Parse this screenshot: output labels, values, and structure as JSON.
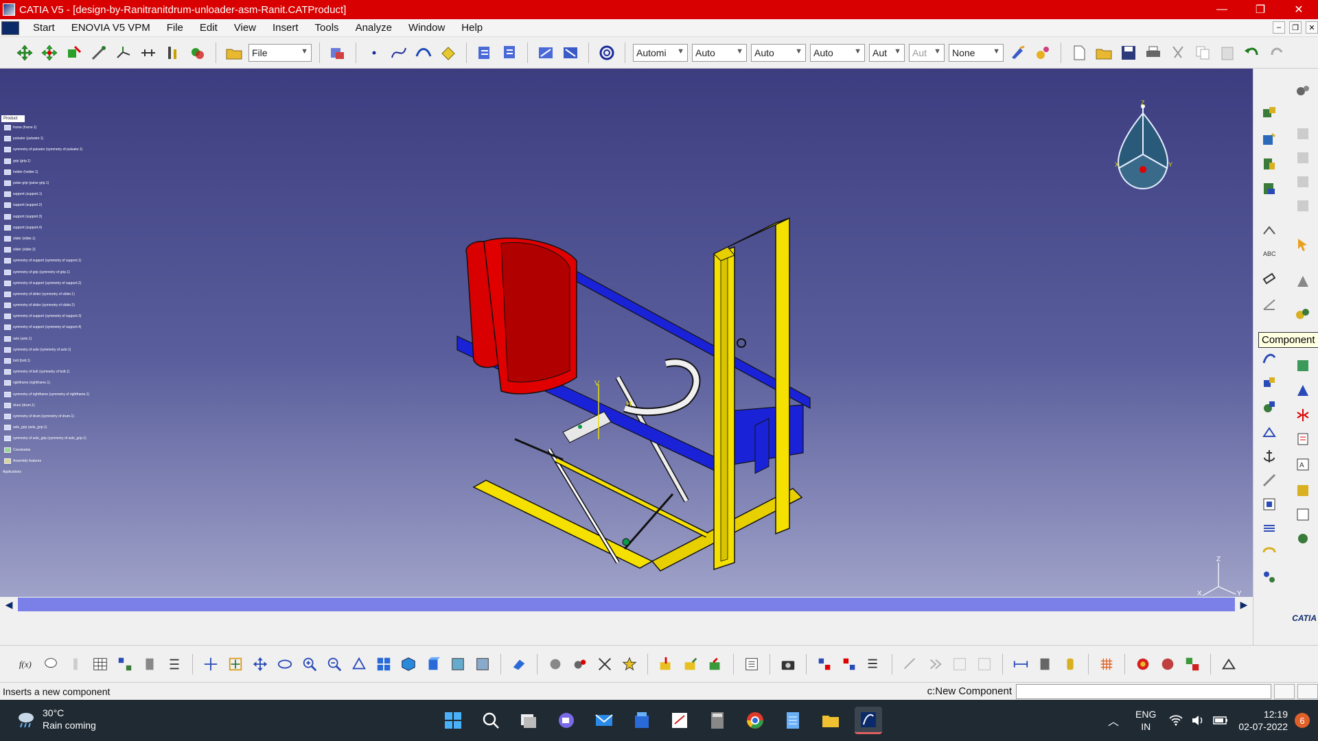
{
  "window": {
    "title": "CATIA V5 - [design-by-Ranitranitdrum-unloader-asm-Ranit.CATProduct]",
    "controls": [
      "—",
      "❐",
      "✕"
    ]
  },
  "menu": {
    "items": [
      {
        "label": "Start"
      },
      {
        "label": "ENOVIA V5 VPM"
      },
      {
        "label": "File"
      },
      {
        "label": "Edit"
      },
      {
        "label": "View"
      },
      {
        "label": "Insert"
      },
      {
        "label": "Tools"
      },
      {
        "label": "Analyze"
      },
      {
        "label": "Window"
      },
      {
        "label": "Help"
      }
    ]
  },
  "toolbar": {
    "file_combo": "File",
    "combos": [
      "Automi",
      "Auto",
      "Auto",
      "Auto",
      "Aut",
      "Aut",
      "None"
    ]
  },
  "tree": {
    "root": "Product",
    "nodes": [
      "frame (frame.1)",
      "pulsator (pulsator.1)",
      "symmetry of pulsator (symmetry of pulsator.1)",
      "grip (grip.1)",
      "holder (holder.1)",
      "pulse grip (pulse grip.1)",
      "support (support.1)",
      "support (support.2)",
      "support (support.3)",
      "support (support.4)",
      "slider (slider.1)",
      "slider (slider.2)",
      "symmetry of support (symmetry of support.1)",
      "symmetry of grip (symmetry of grip.1)",
      "symmetry of support (symmetry of support.2)",
      "symmetry of slider (symmetry of slider.1)",
      "symmetry of slider (symmetry of slider.2)",
      "symmetry of support (symmetry of support.3)",
      "symmetry of support (symmetry of support.4)",
      "axle (axle.1)",
      "symmetry of axle (symmetry of axle.1)",
      "bolt (bolt.1)",
      "symmetry of bolt (symmetry of bolt.1)",
      "rightframe (rightframe.1)",
      "symmetry of rightframe (symmetry of rightframe.1)",
      "drum (drum.1)",
      "symmetry of drum (symmetry of drum.1)",
      "axle_grip (axle_grip.1)",
      "symmetry of axle_grip (symmetry of axle_grip.1)",
      "Constraints",
      "Assembly features",
      "Applications"
    ]
  },
  "compass": {
    "axis_z": "Z",
    "axis_x": "X",
    "axis_y": "Y"
  },
  "axes": {
    "z": "Z",
    "x": "X",
    "y": "Y"
  },
  "tooltip": "Component",
  "logo": "CATIA",
  "status": {
    "message": "Inserts a new component",
    "command_label": "c:New Component"
  },
  "taskbar": {
    "weather_temp": "30°C",
    "weather_text": "Rain coming",
    "lang_1": "ENG",
    "lang_2": "IN",
    "time": "12:19",
    "date": "02-07-2022",
    "notifications": "6"
  },
  "colors": {
    "titlebar": "#d80000",
    "viewport_top": "#3c3d80",
    "frame_yellow": "#f5e000",
    "arm_blue": "#1a22d8",
    "drum_red": "#e00000"
  }
}
